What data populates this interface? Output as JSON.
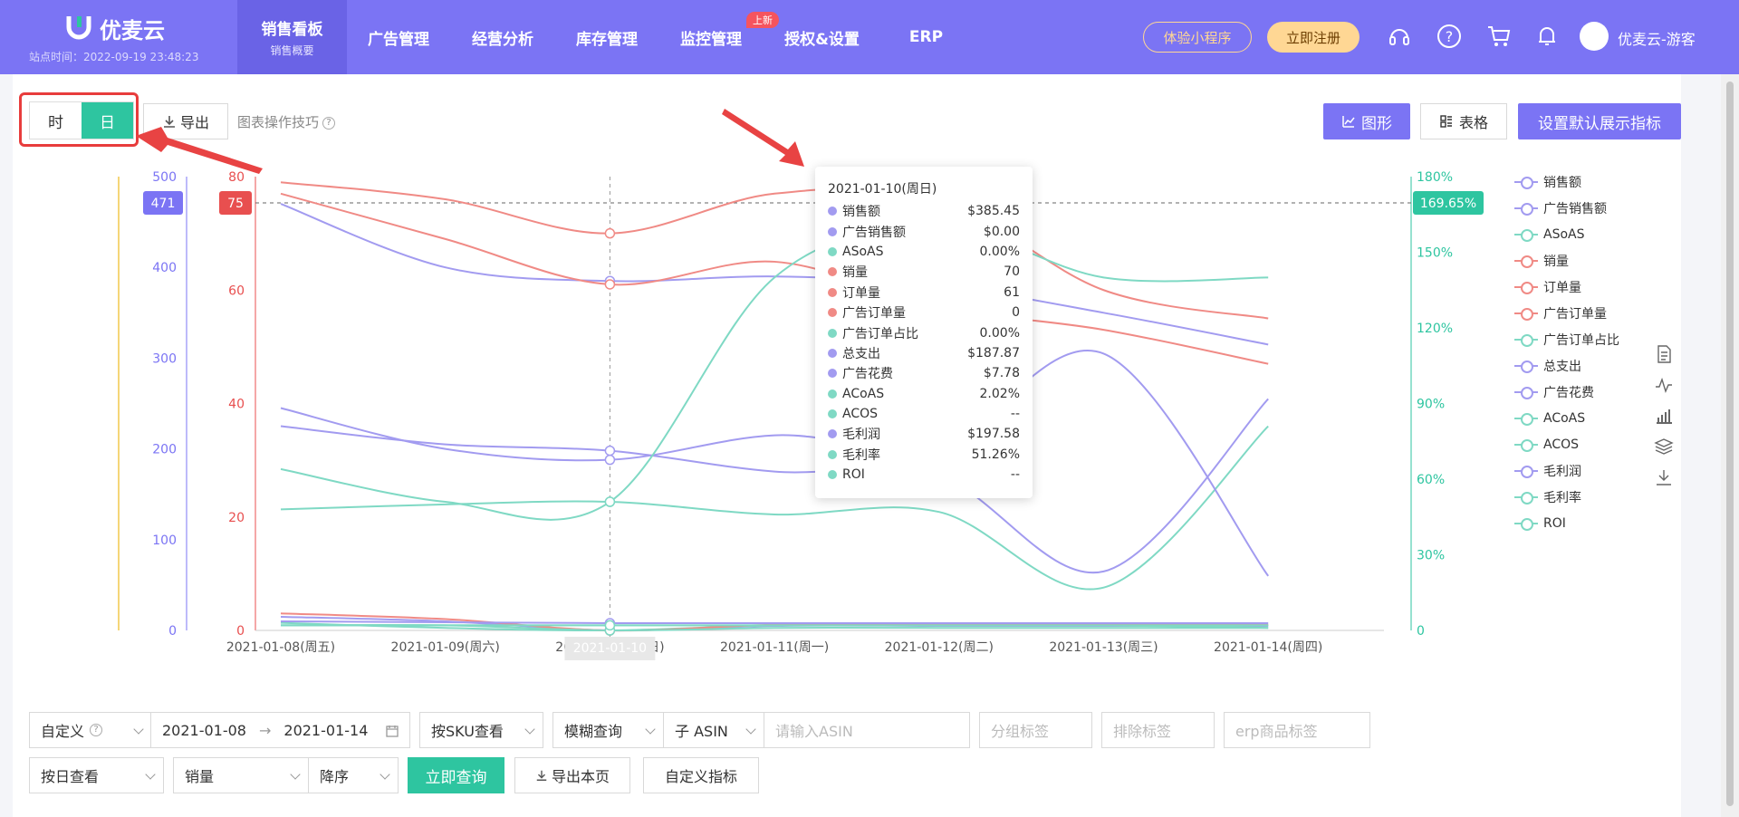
{
  "brand": {
    "name": "优麦云",
    "time_label": "站点时间：2022-09-19 23:48:23"
  },
  "nav": {
    "items": [
      {
        "label": "销售看板",
        "sub": "销售概要"
      },
      {
        "label": "广告管理"
      },
      {
        "label": "经营分析"
      },
      {
        "label": "库存管理"
      },
      {
        "label": "监控管理"
      },
      {
        "label": "授权&设置"
      },
      {
        "label": "ERP"
      }
    ],
    "new_badge": "上新",
    "mini_program": "体验小程序",
    "register": "立即注册",
    "user": "优麦云-游客"
  },
  "toolbar": {
    "hour": "时",
    "day": "日",
    "export": "导出",
    "tips": "图表操作技巧",
    "chart_btn": "图形",
    "table_btn": "表格",
    "default_btn": "设置默认展示指标"
  },
  "tooltip": {
    "title": "2021-01-10(周日)",
    "rows": [
      {
        "name": "销售额",
        "value": "$385.45",
        "color": "#a29bf0"
      },
      {
        "name": "广告销售额",
        "value": "$0.00",
        "color": "#a29bf0"
      },
      {
        "name": "ASoAS",
        "value": "0.00%",
        "color": "#7fd9c4"
      },
      {
        "name": "销量",
        "value": "70",
        "color": "#f08a85"
      },
      {
        "name": "订单量",
        "value": "61",
        "color": "#f08a85"
      },
      {
        "name": "广告订单量",
        "value": "0",
        "color": "#f08a85"
      },
      {
        "name": "广告订单占比",
        "value": "0.00%",
        "color": "#7fd9c4"
      },
      {
        "name": "总支出",
        "value": "$187.87",
        "color": "#a29bf0"
      },
      {
        "name": "广告花费",
        "value": "$7.78",
        "color": "#a29bf0"
      },
      {
        "name": "ACoAS",
        "value": "2.02%",
        "color": "#7fd9c4"
      },
      {
        "name": "ACOS",
        "value": "--",
        "color": "#7fd9c4"
      },
      {
        "name": "毛利润",
        "value": "$197.58",
        "color": "#a29bf0"
      },
      {
        "name": "毛利率",
        "value": "51.26%",
        "color": "#7fd9c4"
      },
      {
        "name": "ROI",
        "value": "--",
        "color": "#7fd9c4"
      }
    ]
  },
  "chart_data": {
    "type": "line",
    "x": [
      "2021-01-08(周五)",
      "2021-01-09(周六)",
      "2021-01-10(周日)",
      "2021-01-11(周一)",
      "2021-01-12(周二)",
      "2021-01-13(周三)",
      "2021-01-14(周四)"
    ],
    "x_highlight": "2021-01-10",
    "left_axis_1": {
      "ticks": [
        "500",
        "400",
        "300",
        "200",
        "100",
        "0"
      ],
      "ylim": [
        0,
        500
      ],
      "marker": "471",
      "color": "#7b74f4"
    },
    "left_axis_2": {
      "ticks": [
        "80",
        "60",
        "40",
        "20",
        "0"
      ],
      "ylim": [
        0,
        80
      ],
      "marker": "75",
      "color": "#e84f4f"
    },
    "right_axis": {
      "ticks": [
        "180%",
        "150%",
        "120%",
        "90%",
        "60%",
        "30%",
        "0"
      ],
      "ylim": [
        0,
        180
      ],
      "marker": "169.65%",
      "color": "#2ec5a0"
    },
    "series": [
      {
        "name": "销售额",
        "axis": "left1",
        "color": "#a29bf0",
        "values": [
          470,
          400,
          385,
          390,
          380,
          350,
          315
        ]
      },
      {
        "name": "广告销售额",
        "axis": "left1",
        "color": "#a29bf0",
        "values": [
          15,
          10,
          0,
          5,
          5,
          5,
          5
        ]
      },
      {
        "name": "ASoAS",
        "axis": "right",
        "color": "#7fd9c4",
        "values": [
          3,
          1,
          0,
          2,
          2,
          2,
          1
        ]
      },
      {
        "name": "销量",
        "axis": "left2",
        "color": "#f08a85",
        "values": [
          79,
          76,
          70,
          77,
          76,
          60,
          55
        ]
      },
      {
        "name": "订单量",
        "axis": "left2",
        "color": "#f08a85",
        "values": [
          77,
          69,
          61,
          65,
          57,
          53,
          47
        ]
      },
      {
        "name": "广告订单量",
        "axis": "left2",
        "color": "#f08a85",
        "values": [
          3,
          2,
          0,
          1,
          1,
          1,
          1
        ]
      },
      {
        "name": "广告订单占比",
        "axis": "right",
        "color": "#7fd9c4",
        "values": [
          48,
          50,
          51,
          46,
          47,
          17,
          81
        ]
      },
      {
        "name": "总支出",
        "axis": "left1",
        "color": "#a29bf0",
        "values": [
          245,
          200,
          188,
          215,
          205,
          305,
          60
        ]
      },
      {
        "name": "广告花费",
        "axis": "left1",
        "color": "#a29bf0",
        "values": [
          10,
          9,
          8,
          8,
          8,
          8,
          8
        ]
      },
      {
        "name": "ACoAS",
        "axis": "right",
        "color": "#7fd9c4",
        "values": [
          2,
          2,
          2,
          2,
          2,
          2,
          2
        ]
      },
      {
        "name": "ACOS",
        "axis": "right",
        "color": "#7fd9c4",
        "values": [
          2,
          2,
          0,
          1,
          1,
          1,
          1
        ]
      },
      {
        "name": "毛利润",
        "axis": "left1",
        "color": "#a29bf0",
        "values": [
          225,
          205,
          198,
          175,
          170,
          65,
          255
        ]
      },
      {
        "name": "毛利率",
        "axis": "right",
        "color": "#7fd9c4",
        "values": [
          64,
          51,
          51,
          140,
          160,
          140,
          140
        ]
      },
      {
        "name": "ROI",
        "axis": "right",
        "color": "#7fd9c4",
        "values": [
          2,
          2,
          2,
          2,
          2,
          2,
          2
        ]
      }
    ]
  },
  "filters": {
    "range_type": "自定义",
    "start": "2021-01-08",
    "end": "2021-01-14",
    "view_by": "按SKU查看",
    "match": "模糊查询",
    "asin_type": "子 ASIN",
    "asin_placeholder": "请输入ASIN",
    "group_tag": "分组标签",
    "exclude_tag": "排除标签",
    "erp_tag": "erp商品标签",
    "period": "按日查看",
    "sort_field": "销量",
    "sort_order": "降序",
    "query": "立即查询",
    "export_page": "导出本页",
    "custom_metric": "自定义指标"
  }
}
